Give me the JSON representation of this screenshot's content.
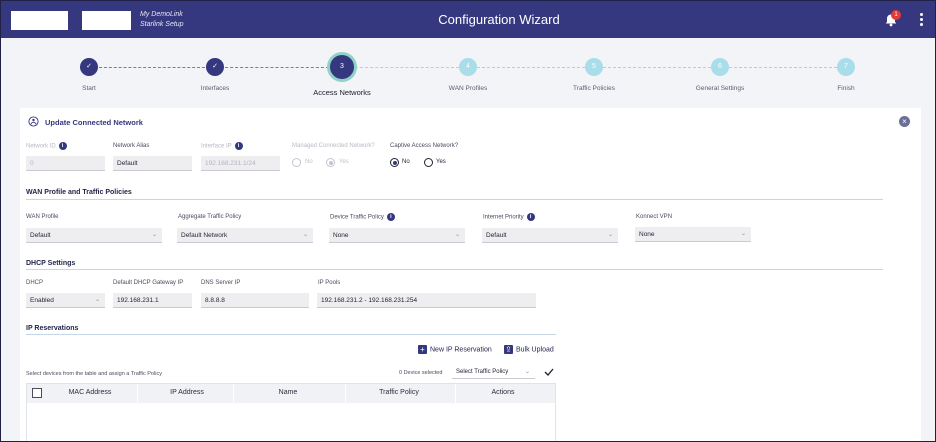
{
  "header": {
    "brand_line1": "My DemoLink",
    "brand_line2": "Starlink Setup",
    "title": "Configuration Wizard",
    "notification_count": "1",
    "icons": [
      "bell-icon",
      "kebab-menu-icon"
    ]
  },
  "stepper": {
    "steps": [
      {
        "label": "Start",
        "marker": "✓",
        "state": "done"
      },
      {
        "label": "Interfaces",
        "marker": "✓",
        "state": "done"
      },
      {
        "label": "Access Networks",
        "marker": "3",
        "state": "current"
      },
      {
        "label": "WAN Profiles",
        "marker": "4",
        "state": "future"
      },
      {
        "label": "Traffic Policies",
        "marker": "5",
        "state": "future"
      },
      {
        "label": "General Settings",
        "marker": "6",
        "state": "future"
      },
      {
        "label": "Finish",
        "marker": "7",
        "state": "future"
      }
    ]
  },
  "card": {
    "title": "Update Connected Network",
    "network_id": {
      "label": "Network ID",
      "value": "0"
    },
    "network_alias": {
      "label": "Network Alias",
      "value": "Default"
    },
    "interface_ip": {
      "label": "Interface IP",
      "value": "192.168.231.1/24"
    },
    "managed": {
      "label": "Managed Connected Network?",
      "options": [
        "No",
        "Yes"
      ],
      "selected": "Yes"
    },
    "captive": {
      "label": "Captive Access Network?",
      "options": [
        "No",
        "Yes"
      ],
      "selected": "No"
    }
  },
  "wan": {
    "section_title": "WAN Profile and Traffic Policies",
    "wan_profile": {
      "label": "WAN Profile",
      "value": "Default"
    },
    "aggregate_policy": {
      "label": "Aggregate Traffic Policy",
      "value": "Default Network"
    },
    "device_policy": {
      "label": "Device Traffic Policy",
      "value": "None"
    },
    "internet_priority": {
      "label": "Internet Priority",
      "value": "Default"
    },
    "konnect_vpn": {
      "label": "Konnect VPN",
      "value": "None"
    }
  },
  "dhcp": {
    "section_title": "DHCP Settings",
    "dhcp": {
      "label": "DHCP",
      "value": "Enabled"
    },
    "gateway": {
      "label": "Default DHCP Gateway IP",
      "value": "192.168.231.1"
    },
    "dns": {
      "label": "DNS Server IP",
      "value": "8.8.8.8"
    },
    "pools": {
      "label": "IP Pools",
      "value": "192.168.231.2 - 192.168.231.254"
    }
  },
  "reservations": {
    "section_title": "IP Reservations",
    "new_label": "New IP Reservation",
    "bulk_label": "Bulk Upload",
    "hint": "Select devices from the table and assign a Traffic Policy",
    "selected_count": "0 Device selected",
    "policy_placeholder": "Select Traffic Policy",
    "columns": [
      "MAC Address",
      "IP Address",
      "Name",
      "Traffic Policy",
      "Actions"
    ]
  },
  "colors": {
    "primary": "#35377f",
    "accent_ring": "#8fd3c6",
    "future_step": "#a9ddea",
    "badge": "#e53935"
  }
}
